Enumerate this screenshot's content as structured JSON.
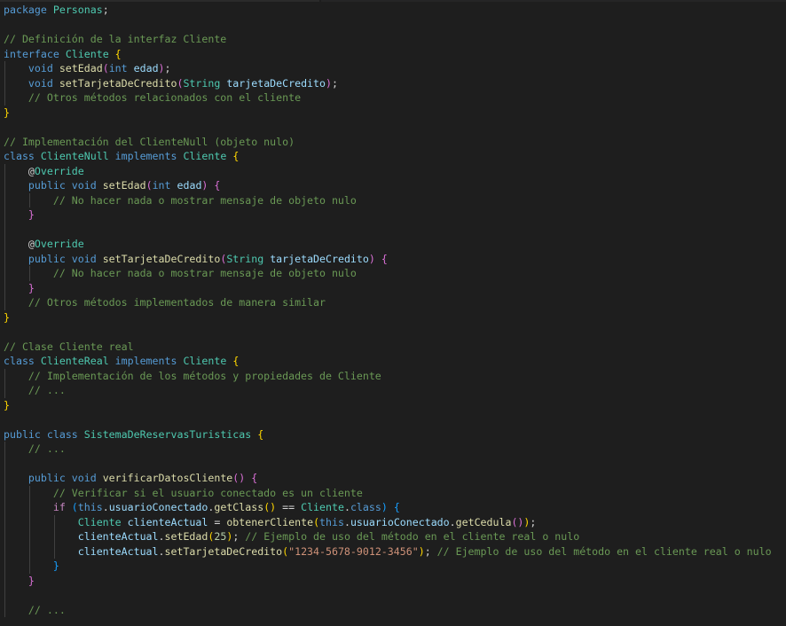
{
  "editor": {
    "language": "java",
    "colors": {
      "background": "#1e1e1e",
      "keyword": "#569cd6",
      "type": "#4ec9b0",
      "function": "#dcdcaa",
      "variable": "#9cdcfe",
      "comment": "#6a9955",
      "string": "#ce9178",
      "number": "#b5cea8"
    },
    "lines": [
      [
        {
          "c": "k",
          "t": "package"
        },
        {
          "c": "p",
          "t": " "
        },
        {
          "c": "t",
          "t": "Personas"
        },
        {
          "c": "p",
          "t": ";"
        }
      ],
      [],
      [
        {
          "c": "c",
          "t": "// Definición de la interfaz Cliente"
        }
      ],
      [
        {
          "c": "k",
          "t": "interface"
        },
        {
          "c": "p",
          "t": " "
        },
        {
          "c": "t",
          "t": "Cliente"
        },
        {
          "c": "p",
          "t": " "
        },
        {
          "c": "b1",
          "t": "{"
        }
      ],
      [
        {
          "c": "p",
          "t": "    "
        },
        {
          "c": "k",
          "t": "void"
        },
        {
          "c": "p",
          "t": " "
        },
        {
          "c": "f",
          "t": "setEdad"
        },
        {
          "c": "b2",
          "t": "("
        },
        {
          "c": "k",
          "t": "int"
        },
        {
          "c": "p",
          "t": " "
        },
        {
          "c": "v",
          "t": "edad"
        },
        {
          "c": "b2",
          "t": ")"
        },
        {
          "c": "p",
          "t": ";"
        }
      ],
      [
        {
          "c": "p",
          "t": "    "
        },
        {
          "c": "k",
          "t": "void"
        },
        {
          "c": "p",
          "t": " "
        },
        {
          "c": "f",
          "t": "setTarjetaDeCredito"
        },
        {
          "c": "b2",
          "t": "("
        },
        {
          "c": "t",
          "t": "String"
        },
        {
          "c": "p",
          "t": " "
        },
        {
          "c": "v",
          "t": "tarjetaDeCredito"
        },
        {
          "c": "b2",
          "t": ")"
        },
        {
          "c": "p",
          "t": ";"
        }
      ],
      [
        {
          "c": "p",
          "t": "    "
        },
        {
          "c": "c",
          "t": "// Otros métodos relacionados con el cliente"
        }
      ],
      [
        {
          "c": "b1",
          "t": "}"
        }
      ],
      [],
      [
        {
          "c": "c",
          "t": "// Implementación del ClienteNull (objeto nulo)"
        }
      ],
      [
        {
          "c": "k",
          "t": "class"
        },
        {
          "c": "p",
          "t": " "
        },
        {
          "c": "t",
          "t": "ClienteNull"
        },
        {
          "c": "p",
          "t": " "
        },
        {
          "c": "k",
          "t": "implements"
        },
        {
          "c": "p",
          "t": " "
        },
        {
          "c": "t",
          "t": "Cliente"
        },
        {
          "c": "p",
          "t": " "
        },
        {
          "c": "b1",
          "t": "{"
        }
      ],
      [
        {
          "c": "p",
          "t": "    "
        },
        {
          "c": "p",
          "t": "@"
        },
        {
          "c": "t",
          "t": "Override"
        }
      ],
      [
        {
          "c": "p",
          "t": "    "
        },
        {
          "c": "k",
          "t": "public"
        },
        {
          "c": "p",
          "t": " "
        },
        {
          "c": "k",
          "t": "void"
        },
        {
          "c": "p",
          "t": " "
        },
        {
          "c": "f",
          "t": "setEdad"
        },
        {
          "c": "b2",
          "t": "("
        },
        {
          "c": "k",
          "t": "int"
        },
        {
          "c": "p",
          "t": " "
        },
        {
          "c": "v",
          "t": "edad"
        },
        {
          "c": "b2",
          "t": ")"
        },
        {
          "c": "p",
          "t": " "
        },
        {
          "c": "b2",
          "t": "{"
        }
      ],
      [
        {
          "c": "p",
          "t": "        "
        },
        {
          "c": "c",
          "t": "// No hacer nada o mostrar mensaje de objeto nulo"
        }
      ],
      [
        {
          "c": "p",
          "t": "    "
        },
        {
          "c": "b2",
          "t": "}"
        }
      ],
      [],
      [
        {
          "c": "p",
          "t": "    "
        },
        {
          "c": "p",
          "t": "@"
        },
        {
          "c": "t",
          "t": "Override"
        }
      ],
      [
        {
          "c": "p",
          "t": "    "
        },
        {
          "c": "k",
          "t": "public"
        },
        {
          "c": "p",
          "t": " "
        },
        {
          "c": "k",
          "t": "void"
        },
        {
          "c": "p",
          "t": " "
        },
        {
          "c": "f",
          "t": "setTarjetaDeCredito"
        },
        {
          "c": "b2",
          "t": "("
        },
        {
          "c": "t",
          "t": "String"
        },
        {
          "c": "p",
          "t": " "
        },
        {
          "c": "v",
          "t": "tarjetaDeCredito"
        },
        {
          "c": "b2",
          "t": ")"
        },
        {
          "c": "p",
          "t": " "
        },
        {
          "c": "b2",
          "t": "{"
        }
      ],
      [
        {
          "c": "p",
          "t": "        "
        },
        {
          "c": "c",
          "t": "// No hacer nada o mostrar mensaje de objeto nulo"
        }
      ],
      [
        {
          "c": "p",
          "t": "    "
        },
        {
          "c": "b2",
          "t": "}"
        }
      ],
      [
        {
          "c": "p",
          "t": "    "
        },
        {
          "c": "c",
          "t": "// Otros métodos implementados de manera similar"
        }
      ],
      [
        {
          "c": "b1",
          "t": "}"
        }
      ],
      [],
      [
        {
          "c": "c",
          "t": "// Clase Cliente real"
        }
      ],
      [
        {
          "c": "k",
          "t": "class"
        },
        {
          "c": "p",
          "t": " "
        },
        {
          "c": "t",
          "t": "ClienteReal"
        },
        {
          "c": "p",
          "t": " "
        },
        {
          "c": "k",
          "t": "implements"
        },
        {
          "c": "p",
          "t": " "
        },
        {
          "c": "t",
          "t": "Cliente"
        },
        {
          "c": "p",
          "t": " "
        },
        {
          "c": "b1",
          "t": "{"
        }
      ],
      [
        {
          "c": "p",
          "t": "    "
        },
        {
          "c": "c",
          "t": "// Implementación de los métodos y propiedades de Cliente"
        }
      ],
      [
        {
          "c": "p",
          "t": "    "
        },
        {
          "c": "c",
          "t": "// ..."
        }
      ],
      [
        {
          "c": "b1",
          "t": "}"
        }
      ],
      [],
      [
        {
          "c": "k",
          "t": "public"
        },
        {
          "c": "p",
          "t": " "
        },
        {
          "c": "k",
          "t": "class"
        },
        {
          "c": "p",
          "t": " "
        },
        {
          "c": "t",
          "t": "SistemaDeReservasTuristicas"
        },
        {
          "c": "p",
          "t": " "
        },
        {
          "c": "b1",
          "t": "{"
        }
      ],
      [
        {
          "c": "p",
          "t": "    "
        },
        {
          "c": "c",
          "t": "// ..."
        }
      ],
      [],
      [
        {
          "c": "p",
          "t": "    "
        },
        {
          "c": "k",
          "t": "public"
        },
        {
          "c": "p",
          "t": " "
        },
        {
          "c": "k",
          "t": "void"
        },
        {
          "c": "p",
          "t": " "
        },
        {
          "c": "f",
          "t": "verificarDatosCliente"
        },
        {
          "c": "b2",
          "t": "()"
        },
        {
          "c": "p",
          "t": " "
        },
        {
          "c": "b2",
          "t": "{"
        }
      ],
      [
        {
          "c": "p",
          "t": "        "
        },
        {
          "c": "c",
          "t": "// Verificar si el usuario conectado es un cliente"
        }
      ],
      [
        {
          "c": "p",
          "t": "        "
        },
        {
          "c": "kc",
          "t": "if"
        },
        {
          "c": "p",
          "t": " "
        },
        {
          "c": "b3",
          "t": "("
        },
        {
          "c": "k",
          "t": "this"
        },
        {
          "c": "p",
          "t": "."
        },
        {
          "c": "v",
          "t": "usuarioConectado"
        },
        {
          "c": "p",
          "t": "."
        },
        {
          "c": "f",
          "t": "getClass"
        },
        {
          "c": "b1",
          "t": "()"
        },
        {
          "c": "p",
          "t": " == "
        },
        {
          "c": "t",
          "t": "Cliente"
        },
        {
          "c": "p",
          "t": "."
        },
        {
          "c": "k",
          "t": "class"
        },
        {
          "c": "b3",
          "t": ")"
        },
        {
          "c": "p",
          "t": " "
        },
        {
          "c": "b3",
          "t": "{"
        }
      ],
      [
        {
          "c": "p",
          "t": "            "
        },
        {
          "c": "t",
          "t": "Cliente"
        },
        {
          "c": "p",
          "t": " "
        },
        {
          "c": "v",
          "t": "clienteActual"
        },
        {
          "c": "p",
          "t": " = "
        },
        {
          "c": "f",
          "t": "obtenerCliente"
        },
        {
          "c": "b1",
          "t": "("
        },
        {
          "c": "k",
          "t": "this"
        },
        {
          "c": "p",
          "t": "."
        },
        {
          "c": "v",
          "t": "usuarioConectado"
        },
        {
          "c": "p",
          "t": "."
        },
        {
          "c": "f",
          "t": "getCedula"
        },
        {
          "c": "b2",
          "t": "()"
        },
        {
          "c": "b1",
          "t": ")"
        },
        {
          "c": "p",
          "t": ";"
        }
      ],
      [
        {
          "c": "p",
          "t": "            "
        },
        {
          "c": "v",
          "t": "clienteActual"
        },
        {
          "c": "p",
          "t": "."
        },
        {
          "c": "f",
          "t": "setEdad"
        },
        {
          "c": "b1",
          "t": "("
        },
        {
          "c": "n",
          "t": "25"
        },
        {
          "c": "b1",
          "t": ")"
        },
        {
          "c": "p",
          "t": "; "
        },
        {
          "c": "c",
          "t": "// Ejemplo de uso del método en el cliente real o nulo"
        }
      ],
      [
        {
          "c": "p",
          "t": "            "
        },
        {
          "c": "v",
          "t": "clienteActual"
        },
        {
          "c": "p",
          "t": "."
        },
        {
          "c": "f",
          "t": "setTarjetaDeCredito"
        },
        {
          "c": "b1",
          "t": "("
        },
        {
          "c": "s",
          "t": "\"1234-5678-9012-3456\""
        },
        {
          "c": "b1",
          "t": ")"
        },
        {
          "c": "p",
          "t": "; "
        },
        {
          "c": "c",
          "t": "// Ejemplo de uso del método en el cliente real o nulo"
        }
      ],
      [
        {
          "c": "p",
          "t": "        "
        },
        {
          "c": "b3",
          "t": "}"
        }
      ],
      [
        {
          "c": "p",
          "t": "    "
        },
        {
          "c": "b2",
          "t": "}"
        }
      ],
      [],
      [
        {
          "c": "p",
          "t": "    "
        },
        {
          "c": "c",
          "t": "// ..."
        }
      ]
    ],
    "guides": [
      {
        "line": 4,
        "cols": [
          0
        ]
      },
      {
        "line": 5,
        "cols": [
          0
        ]
      },
      {
        "line": 6,
        "cols": [
          0
        ]
      },
      {
        "line": 11,
        "cols": [
          0
        ]
      },
      {
        "line": 12,
        "cols": [
          0
        ]
      },
      {
        "line": 13,
        "cols": [
          0,
          4
        ]
      },
      {
        "line": 14,
        "cols": [
          0
        ]
      },
      {
        "line": 15,
        "cols": [
          0
        ]
      },
      {
        "line": 16,
        "cols": [
          0
        ]
      },
      {
        "line": 17,
        "cols": [
          0
        ]
      },
      {
        "line": 18,
        "cols": [
          0,
          4
        ]
      },
      {
        "line": 19,
        "cols": [
          0
        ]
      },
      {
        "line": 20,
        "cols": [
          0
        ]
      },
      {
        "line": 25,
        "cols": [
          0
        ]
      },
      {
        "line": 26,
        "cols": [
          0
        ]
      },
      {
        "line": 30,
        "cols": [
          0
        ]
      },
      {
        "line": 31,
        "cols": [
          0
        ]
      },
      {
        "line": 32,
        "cols": [
          0
        ]
      },
      {
        "line": 33,
        "cols": [
          0,
          4
        ]
      },
      {
        "line": 34,
        "cols": [
          0,
          4
        ]
      },
      {
        "line": 35,
        "cols": [
          0,
          4,
          8
        ]
      },
      {
        "line": 36,
        "cols": [
          0,
          4,
          8
        ]
      },
      {
        "line": 37,
        "cols": [
          0,
          4,
          8
        ]
      },
      {
        "line": 38,
        "cols": [
          0,
          4
        ]
      },
      {
        "line": 39,
        "cols": [
          0
        ]
      },
      {
        "line": 40,
        "cols": [
          0
        ]
      },
      {
        "line": 41,
        "cols": [
          0
        ]
      }
    ]
  }
}
